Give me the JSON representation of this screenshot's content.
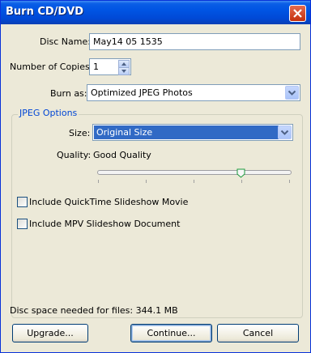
{
  "window": {
    "title": "Burn CD/DVD"
  },
  "disc_name": {
    "label": "Disc Name:",
    "value": "May14 05 1535"
  },
  "copies": {
    "label": "Number of Copies:",
    "value": "1"
  },
  "burn_as": {
    "label": "Burn as:",
    "value": "Optimized JPEG Photos"
  },
  "jpeg_options": {
    "title": "JPEG Options",
    "size_label": "Size:",
    "size_value": "Original Size",
    "quality_label": "Quality:",
    "quality_value": "Good Quality",
    "quality_level": 0.75
  },
  "options": {
    "quicktime": {
      "label": "Include QuickTime Slideshow Movie",
      "checked": false
    },
    "mpv": {
      "label": "Include MPV Slideshow Document",
      "checked": false
    }
  },
  "disc_space": "Disc space needed for files: 344.1 MB",
  "buttons": {
    "upgrade": "Upgrade...",
    "continue": "Continue...",
    "cancel": "Cancel"
  },
  "colors": {
    "titlebar": "#0054e3",
    "selection": "#316ac5",
    "group_title": "#0046d5",
    "face": "#ece9d8"
  }
}
